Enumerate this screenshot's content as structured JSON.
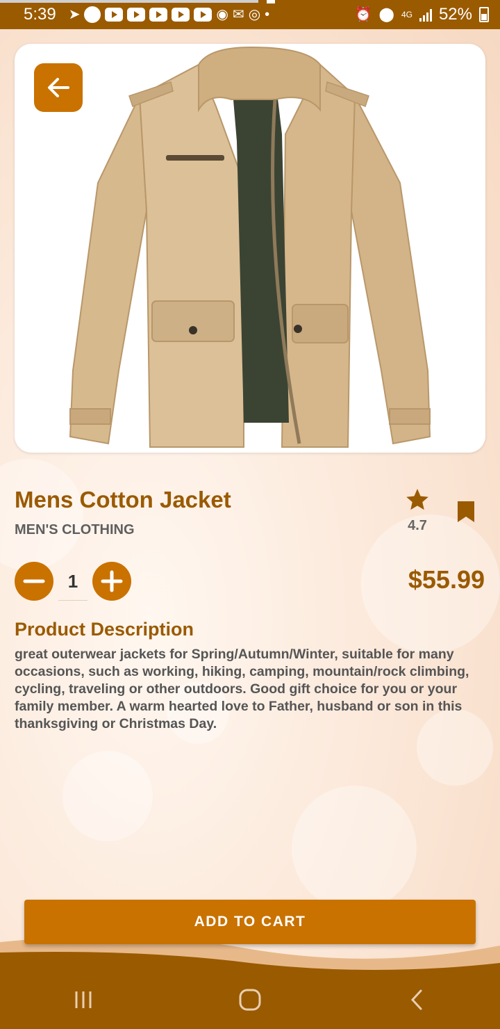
{
  "status_bar": {
    "time": "5:39",
    "network": "4G",
    "battery": "52%"
  },
  "product": {
    "title": "Mens Cotton Jacket",
    "category": "MEN'S CLOTHING",
    "rating": "4.7",
    "quantity": "1",
    "price": "$55.99",
    "image_icon": "khaki-jacket-photo"
  },
  "description": {
    "heading": "Product Description",
    "text": "great outerwear jackets for Spring/Autumn/Winter, suitable for many occasions, such as working, hiking, camping, mountain/rock climbing, cycling, traveling or other outdoors. Good gift choice for you or your family member. A warm hearted love to Father, husband or son in this thanksgiving or Christmas Day."
  },
  "actions": {
    "add_to_cart": "ADD TO CART"
  },
  "icons": {
    "back": "arrow-left-icon",
    "star": "star-icon",
    "bookmark": "bookmark-icon",
    "minus": "minus-icon",
    "plus": "plus-icon"
  },
  "colors": {
    "accent": "#c97200",
    "brand_dark": "#9a5a00",
    "status_bar": "#9a5a00"
  }
}
